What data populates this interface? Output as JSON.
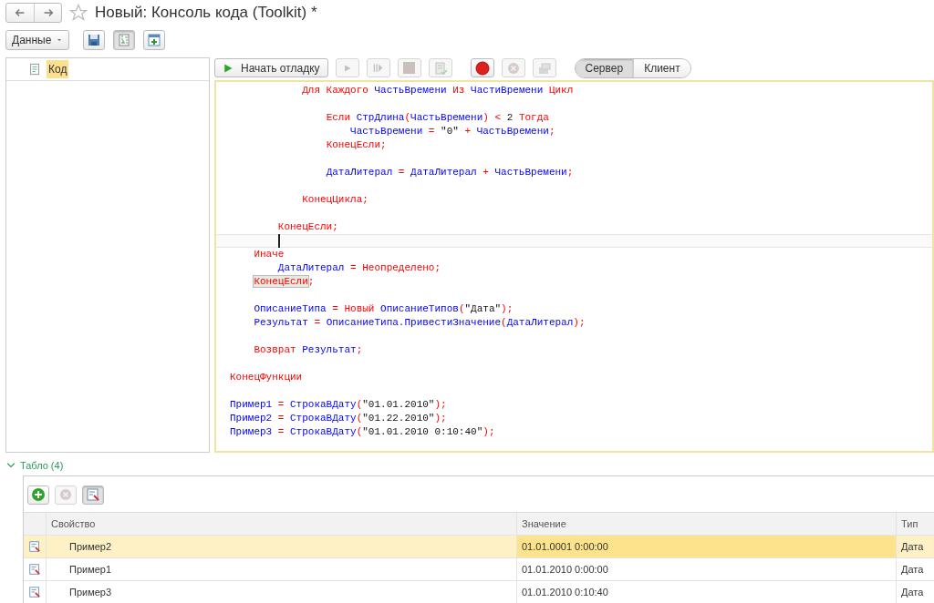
{
  "window": {
    "title": "Новый: Консоль кода (Toolkit) *"
  },
  "toolbar": [
    {
      "kind": "dropdown",
      "label": "Данные",
      "pressed": false
    },
    {
      "kind": "save",
      "pressed": false
    },
    {
      "kind": "tree",
      "pressed": true
    },
    {
      "kind": "add-window",
      "pressed": false
    }
  ],
  "tree": {
    "items": [
      {
        "label": "Код",
        "selected": true
      }
    ]
  },
  "debug_toolbar": {
    "start": {
      "label": "Начать отладку"
    },
    "buttons": [
      {
        "kind": "run",
        "disabled": true
      },
      {
        "kind": "step",
        "disabled": true
      },
      {
        "kind": "stop",
        "disabled": true
      },
      {
        "kind": "check",
        "disabled": true
      },
      {
        "kind": "breakpoint",
        "disabled": false
      },
      {
        "kind": "remove",
        "disabled": true
      },
      {
        "kind": "stack",
        "disabled": true
      }
    ],
    "mode": [
      {
        "label": "Сервер",
        "selected": true
      },
      {
        "label": "Клиент",
        "selected": false
      }
    ]
  },
  "code": [
    {
      "kind": "text",
      "segments": [
        {
          "t": "            Для Каждого ",
          "kind": "keyword"
        },
        {
          "t": "ЧастьВремени ",
          "kind": "identifier"
        },
        {
          "t": "Из ",
          "kind": "keyword"
        },
        {
          "t": "ЧастиВремени ",
          "kind": "identifier"
        },
        {
          "t": "Цикл",
          "kind": "keyword"
        }
      ]
    },
    {
      "kind": "blank"
    },
    {
      "kind": "text",
      "segments": [
        {
          "t": "                Если ",
          "kind": "keyword"
        },
        {
          "t": "СтрДлина",
          "kind": "identifier"
        },
        {
          "t": "(",
          "kind": "keyword"
        },
        {
          "t": "ЧастьВремени",
          "kind": "identifier"
        },
        {
          "t": ") < ",
          "kind": "keyword"
        },
        {
          "t": "2 ",
          "kind": "literal"
        },
        {
          "t": "Тогда",
          "kind": "keyword"
        }
      ]
    },
    {
      "kind": "text",
      "segments": [
        {
          "t": "                    ЧастьВремени ",
          "kind": "identifier"
        },
        {
          "t": "= ",
          "kind": "keyword"
        },
        {
          "t": "\"0\" ",
          "kind": "literal"
        },
        {
          "t": "+ ",
          "kind": "keyword"
        },
        {
          "t": "ЧастьВремени",
          "kind": "identifier"
        },
        {
          "t": ";",
          "kind": "keyword"
        }
      ]
    },
    {
      "kind": "text",
      "segments": [
        {
          "t": "                КонецЕсли;",
          "kind": "keyword"
        }
      ]
    },
    {
      "kind": "blank"
    },
    {
      "kind": "text",
      "segments": [
        {
          "t": "                ДатаЛитерал ",
          "kind": "identifier"
        },
        {
          "t": "= ",
          "kind": "keyword"
        },
        {
          "t": "ДатаЛитерал ",
          "kind": "identifier"
        },
        {
          "t": "+ ",
          "kind": "keyword"
        },
        {
          "t": "ЧастьВремени",
          "kind": "identifier"
        },
        {
          "t": ";",
          "kind": "keyword"
        }
      ]
    },
    {
      "kind": "blank"
    },
    {
      "kind": "text",
      "segments": [
        {
          "t": "            КонецЦикла;",
          "kind": "keyword"
        }
      ]
    },
    {
      "kind": "blank"
    },
    {
      "kind": "text",
      "segments": [
        {
          "t": "        КонецЕсли;",
          "kind": "keyword"
        }
      ]
    },
    {
      "kind": "cursor"
    },
    {
      "kind": "text",
      "segments": [
        {
          "t": "    Иначе",
          "kind": "keyword"
        }
      ]
    },
    {
      "kind": "text",
      "segments": [
        {
          "t": "        ДатаЛитерал ",
          "kind": "identifier"
        },
        {
          "t": "= Неопределено;",
          "kind": "keyword"
        }
      ]
    },
    {
      "kind": "text",
      "segments": [
        {
          "t": "    КонецЕсли",
          "kind": "match"
        },
        {
          "t": ";",
          "kind": "keyword"
        }
      ]
    },
    {
      "kind": "blank"
    },
    {
      "kind": "text",
      "segments": [
        {
          "t": "    ОписаниеТипа ",
          "kind": "identifier"
        },
        {
          "t": "= Новый ",
          "kind": "keyword"
        },
        {
          "t": "ОписаниеТипов",
          "kind": "identifier"
        },
        {
          "t": "(",
          "kind": "keyword"
        },
        {
          "t": "\"Дата\"",
          "kind": "literal"
        },
        {
          "t": ");",
          "kind": "keyword"
        }
      ]
    },
    {
      "kind": "text",
      "segments": [
        {
          "t": "    Результат ",
          "kind": "identifier"
        },
        {
          "t": "= ",
          "kind": "keyword"
        },
        {
          "t": "ОписаниеТипа.ПривестиЗначение",
          "kind": "identifier"
        },
        {
          "t": "(",
          "kind": "keyword"
        },
        {
          "t": "ДатаЛитерал",
          "kind": "identifier"
        },
        {
          "t": ");",
          "kind": "keyword"
        }
      ]
    },
    {
      "kind": "blank"
    },
    {
      "kind": "text",
      "segments": [
        {
          "t": "    Возврат ",
          "kind": "keyword"
        },
        {
          "t": "Результат",
          "kind": "identifier"
        },
        {
          "t": ";",
          "kind": "keyword"
        }
      ]
    },
    {
      "kind": "blank"
    },
    {
      "kind": "text",
      "segments": [
        {
          "t": "КонецФункции",
          "kind": "keyword"
        }
      ]
    },
    {
      "kind": "blank"
    },
    {
      "kind": "text",
      "segments": [
        {
          "t": "Пример1 ",
          "kind": "identifier"
        },
        {
          "t": "= ",
          "kind": "keyword"
        },
        {
          "t": "СтрокаВДату",
          "kind": "identifier"
        },
        {
          "t": "(",
          "kind": "keyword"
        },
        {
          "t": "\"01.01.2010\"",
          "kind": "literal"
        },
        {
          "t": ");",
          "kind": "keyword"
        }
      ]
    },
    {
      "kind": "text",
      "segments": [
        {
          "t": "Пример2 ",
          "kind": "identifier"
        },
        {
          "t": "= ",
          "kind": "keyword"
        },
        {
          "t": "СтрокаВДату",
          "kind": "identifier"
        },
        {
          "t": "(",
          "kind": "keyword"
        },
        {
          "t": "\"01.22.2010\"",
          "kind": "literal"
        },
        {
          "t": ");",
          "kind": "keyword"
        }
      ]
    },
    {
      "kind": "text",
      "segments": [
        {
          "t": "Пример3 ",
          "kind": "identifier"
        },
        {
          "t": "= ",
          "kind": "keyword"
        },
        {
          "t": "СтрокаВДату",
          "kind": "identifier"
        },
        {
          "t": "(",
          "kind": "keyword"
        },
        {
          "t": "\"01.01.2010 0:10:40\"",
          "kind": "literal"
        },
        {
          "t": ");",
          "kind": "keyword"
        }
      ]
    }
  ],
  "board": {
    "title": "Табло (4)",
    "expanded": true,
    "buttons": [
      {
        "kind": "add",
        "disabled": false
      },
      {
        "kind": "remove",
        "disabled": true
      },
      {
        "kind": "inspect",
        "disabled": false
      }
    ],
    "table": {
      "columns": [
        "Свойство",
        "Значение",
        "Тип"
      ],
      "rows": [
        {
          "name": "Пример2",
          "value": "01.01.0001 0:00:00",
          "type": "Дата",
          "selected": true
        },
        {
          "name": "Пример1",
          "value": "01.01.2010 0:00:00",
          "type": "Дата",
          "selected": false
        },
        {
          "name": "Пример3",
          "value": "01.01.2010 0:10:40",
          "type": "Дата",
          "selected": false
        }
      ]
    }
  }
}
